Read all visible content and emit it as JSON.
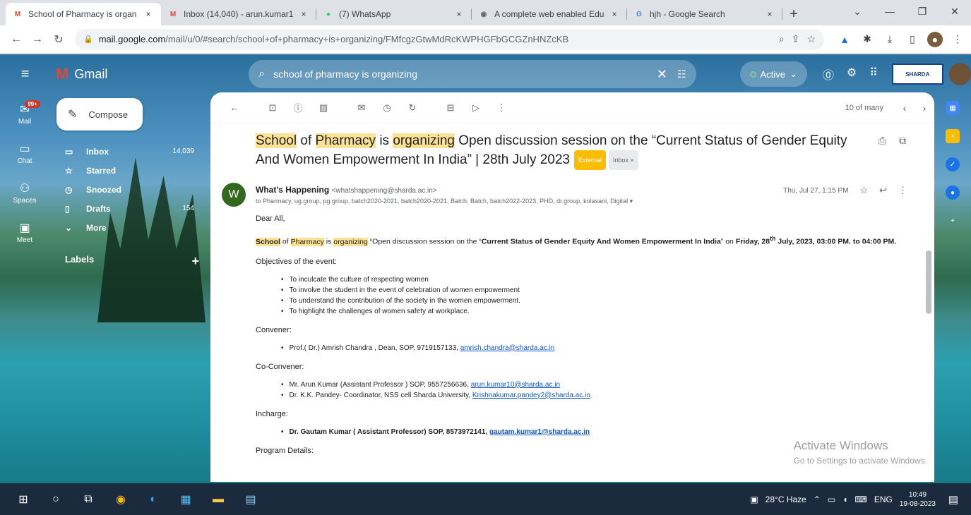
{
  "browser": {
    "tabs": [
      {
        "icon": "gmail-icon",
        "glyph": "M",
        "color": "#ea4335",
        "title": "School of Pharmacy is organ",
        "close": "×"
      },
      {
        "icon": "gmail-icon",
        "glyph": "M",
        "color": "#ea4335",
        "title": "Inbox (14,040) - arun.kumar1",
        "close": "×"
      },
      {
        "icon": "whatsapp-icon",
        "glyph": "●",
        "color": "#25d366",
        "title": "(7) WhatsApp",
        "close": "×"
      },
      {
        "icon": "web-icon",
        "glyph": "◉",
        "color": "#5f6368",
        "title": "A complete web enabled Edu",
        "close": "×"
      },
      {
        "icon": "google-icon",
        "glyph": "G",
        "color": "#4285f4",
        "title": "hjh - Google Search",
        "close": "×"
      }
    ],
    "new_tab": "+",
    "url_host": "mail.google.com",
    "url_rest": "/mail/u/0/#search/school+of+pharmacy+is+organizing/FMfcgzGtwMdRcKWPHGFbGCGZnHNZcKB"
  },
  "gmail": {
    "app_name": "Gmail",
    "search_query": "school of pharmacy is organizing",
    "status": "Active",
    "org_logo": "SHARDA",
    "compose_label": "Compose",
    "rail": [
      {
        "icon": "mail-icon",
        "glyph": "✉",
        "label": "Mail",
        "badge": "99+"
      },
      {
        "icon": "chat-icon",
        "glyph": "▭",
        "label": "Chat"
      },
      {
        "icon": "spaces-icon",
        "glyph": "⚇",
        "label": "Spaces"
      },
      {
        "icon": "meet-icon",
        "glyph": "▣",
        "label": "Meet"
      }
    ],
    "nav": [
      {
        "icon": "inbox-icon",
        "glyph": "▭",
        "label": "Inbox",
        "count": "14,039"
      },
      {
        "icon": "star-icon",
        "glyph": "☆",
        "label": "Starred",
        "count": ""
      },
      {
        "icon": "clock-icon",
        "glyph": "◷",
        "label": "Snoozed",
        "count": ""
      },
      {
        "icon": "draft-icon",
        "glyph": "▯",
        "label": "Drafts",
        "count": "154"
      },
      {
        "icon": "chevron-down-icon",
        "glyph": "⌄",
        "label": "More",
        "count": ""
      }
    ],
    "labels_heading": "Labels",
    "pagination": "10 of many"
  },
  "email": {
    "subject_parts": [
      {
        "text": "School",
        "hl": true
      },
      {
        "text": " of ",
        "hl": false
      },
      {
        "text": "Pharmacy",
        "hl": true
      },
      {
        "text": " is ",
        "hl": false
      },
      {
        "text": "organizing",
        "hl": true
      },
      {
        "text": " Open discussion session on the “Current Status of Gender Equity And Women Empowerment In India” | 28th July 2023",
        "hl": false
      }
    ],
    "tag_external": "External",
    "tag_inbox": "Inbox ×",
    "sender_initial": "W",
    "sender_name": "What's Happening",
    "sender_email": "<whatshappening@sharda.ac.in>",
    "to": "to Pharmacy, ug.group, pg.group, batch2020-2021, batch2020-2021, Batch, Batch, batch2022-2023, PHD, dr.group, kolasani, Digital ▾",
    "date": "Thu, Jul 27, 1:15 PM",
    "greeting": "Dear All,",
    "intro": {
      "w1": "School",
      "t1": " of ",
      "w2": "Pharmacy",
      "t2": " is ",
      "w3": "organizing",
      "t3": " “Open discussion session on the “",
      "b1": "Current Status of Gender Equity And Women Empowerment In India",
      "t4": "” on ",
      "b2": "Friday, 28",
      "sup": "th",
      "b3": " July, 2023, 03:00 PM. to 04:00 PM."
    },
    "objectives_heading": "Objectives of the event:",
    "objectives": [
      "To inculcate the culture of respecting women",
      "To involve the student in the event of celebration of women empowerment",
      "To understand the contribution of the society in the women empowerment.",
      "To highlight the challenges of women safety at workplace."
    ],
    "convener_heading": "Convener:",
    "convener": {
      "text": "Prof.( Dr.) Amrish Chandra , Dean, SOP, 9719157133, ",
      "link": "amrish.chandra@sharda.ac.in"
    },
    "coconvener_heading": "Co-Convener:",
    "coconveners": [
      {
        "text": "Mr. Arun Kumar (Assistant  Professor ) SOP, 9557256636, ",
        "link": "arun.kumar10@sharda.ac.in"
      },
      {
        "text": "Dr. K.K. Pandey- Coordinator, NSS cell Sharda University, ",
        "link": "Krishnakumar.pandey2@sharda.ac.in"
      }
    ],
    "incharge_heading": "Incharge:",
    "incharge": {
      "text": "Dr. Gautam Kumar ( Assistant  Professor) SOP, 8573972141, ",
      "link": "gautam.kumar1@sharda.ac.in"
    },
    "program_heading": "Program Details:"
  },
  "watermark": {
    "line1": "Activate Windows",
    "line2": "Go to Settings to activate Windows."
  },
  "taskbar": {
    "weather": "28°C  Haze",
    "lang": "ENG",
    "time": "10:49",
    "date": "19-08-2023"
  }
}
